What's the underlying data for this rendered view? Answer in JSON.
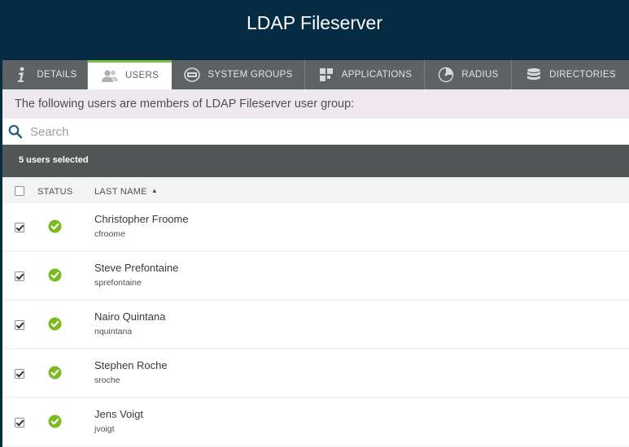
{
  "header": {
    "title": "LDAP Fileserver"
  },
  "tabs": [
    {
      "label": "DETAILS",
      "icon": "info-icon",
      "active": false
    },
    {
      "label": "USERS",
      "icon": "users-icon",
      "active": true
    },
    {
      "label": "SYSTEM GROUPS",
      "icon": "system-groups-icon",
      "active": false
    },
    {
      "label": "APPLICATIONS",
      "icon": "applications-icon",
      "active": false
    },
    {
      "label": "RADIUS",
      "icon": "radius-icon",
      "active": false
    },
    {
      "label": "DIRECTORIES",
      "icon": "directories-icon",
      "active": false
    }
  ],
  "intro": {
    "text": "The following users are members of LDAP Fileserver user group:"
  },
  "search": {
    "placeholder": "Search",
    "value": ""
  },
  "selection": {
    "text": "5 users selected"
  },
  "table": {
    "columns": {
      "status": "STATUS",
      "last_name": "LAST NAME"
    },
    "sort": {
      "column": "last_name",
      "direction": "ascending"
    },
    "rows": [
      {
        "name": "Christopher Froome",
        "username": "cfroome",
        "selected": true,
        "status": "active"
      },
      {
        "name": "Steve Prefontaine",
        "username": "sprefontaine",
        "selected": true,
        "status": "active"
      },
      {
        "name": "Nairo Quintana",
        "username": "nquintana",
        "selected": true,
        "status": "active"
      },
      {
        "name": "Stephen Roche",
        "username": "sroche",
        "selected": true,
        "status": "active"
      },
      {
        "name": "Jens Voigt",
        "username": "jvoigt",
        "selected": true,
        "status": "active"
      }
    ]
  },
  "colors": {
    "header_bg": "#062c43",
    "tab_bar": "#5f6263",
    "active_tab_accent": "#7dc142",
    "status_ok": "#7cba21",
    "selection_bar": "#525657"
  }
}
